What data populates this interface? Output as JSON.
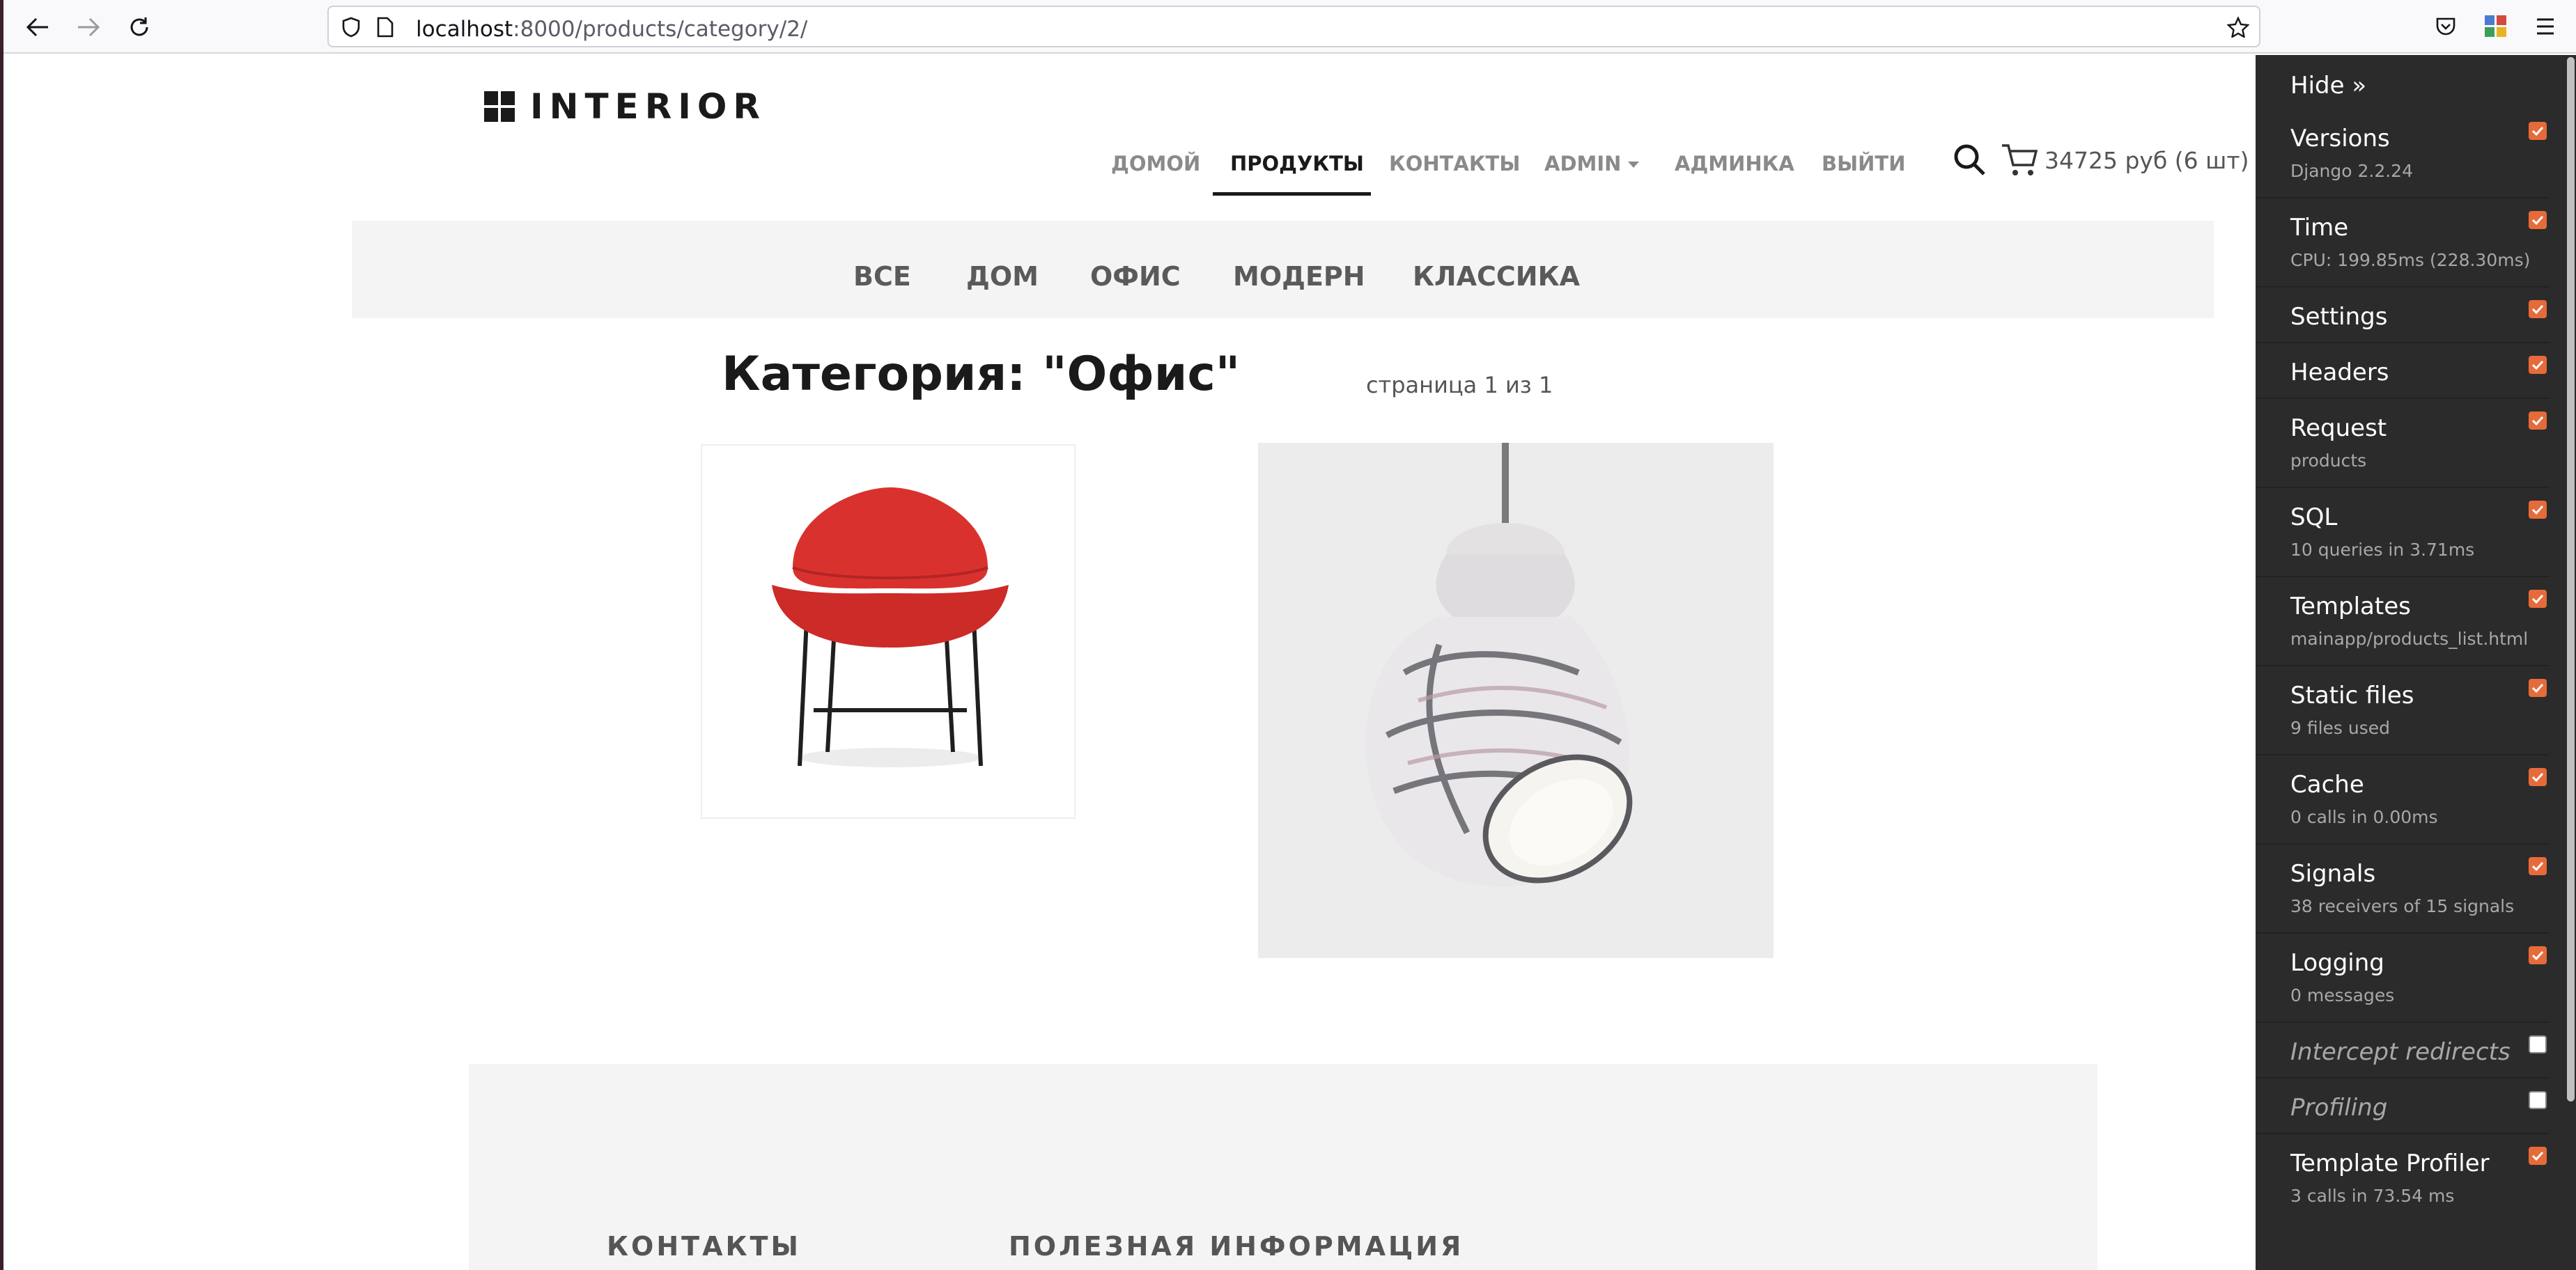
{
  "browser": {
    "url_host": "localhost",
    "url_rest": ":8000/products/category/2/"
  },
  "site": {
    "logo": "INTERIOR",
    "nav": [
      "ДОМОЙ",
      "ПРОДУКТЫ",
      "КОНТАКТЫ",
      "ADMIN",
      "АДМИНКА",
      "ВЫЙТИ"
    ],
    "active_nav": "ПРОДУКТЫ",
    "cart": "34725 руб (6 шт)"
  },
  "categories": [
    "ВСЕ",
    "ДОМ",
    "ОФИС",
    "МОДЕРН",
    "КЛАССИКА"
  ],
  "main": {
    "heading": "Категория: \"Офис\"",
    "page_info": "страница 1 из 1"
  },
  "footer": {
    "contacts": "КОНТАКТЫ",
    "useful_info": "ПОЛЕЗНАЯ ИНФОРМАЦИЯ"
  },
  "debug_toolbar": {
    "hide": "Hide »",
    "panels": [
      {
        "title": "Versions",
        "sub": "Django 2.2.24",
        "checked": true
      },
      {
        "title": "Time",
        "sub": "CPU: 199.85ms (228.30ms)",
        "checked": true
      },
      {
        "title": "Settings",
        "sub": "",
        "checked": true
      },
      {
        "title": "Headers",
        "sub": "",
        "checked": true
      },
      {
        "title": "Request",
        "sub": "products",
        "checked": true
      },
      {
        "title": "SQL",
        "sub": "10 queries in 3.71ms",
        "checked": true
      },
      {
        "title": "Templates",
        "sub": "mainapp/products_list.html",
        "checked": true
      },
      {
        "title": "Static files",
        "sub": "9 files used",
        "checked": true
      },
      {
        "title": "Cache",
        "sub": "0 calls in 0.00ms",
        "checked": true
      },
      {
        "title": "Signals",
        "sub": "38 receivers of 15 signals",
        "checked": true
      },
      {
        "title": "Logging",
        "sub": "0 messages",
        "checked": true
      },
      {
        "title": "Intercept redirects",
        "sub": "",
        "checked": false
      },
      {
        "title": "Profiling",
        "sub": "",
        "checked": false
      },
      {
        "title": "Template Profiler",
        "sub": "3 calls in 73.54 ms",
        "checked": true
      }
    ]
  }
}
